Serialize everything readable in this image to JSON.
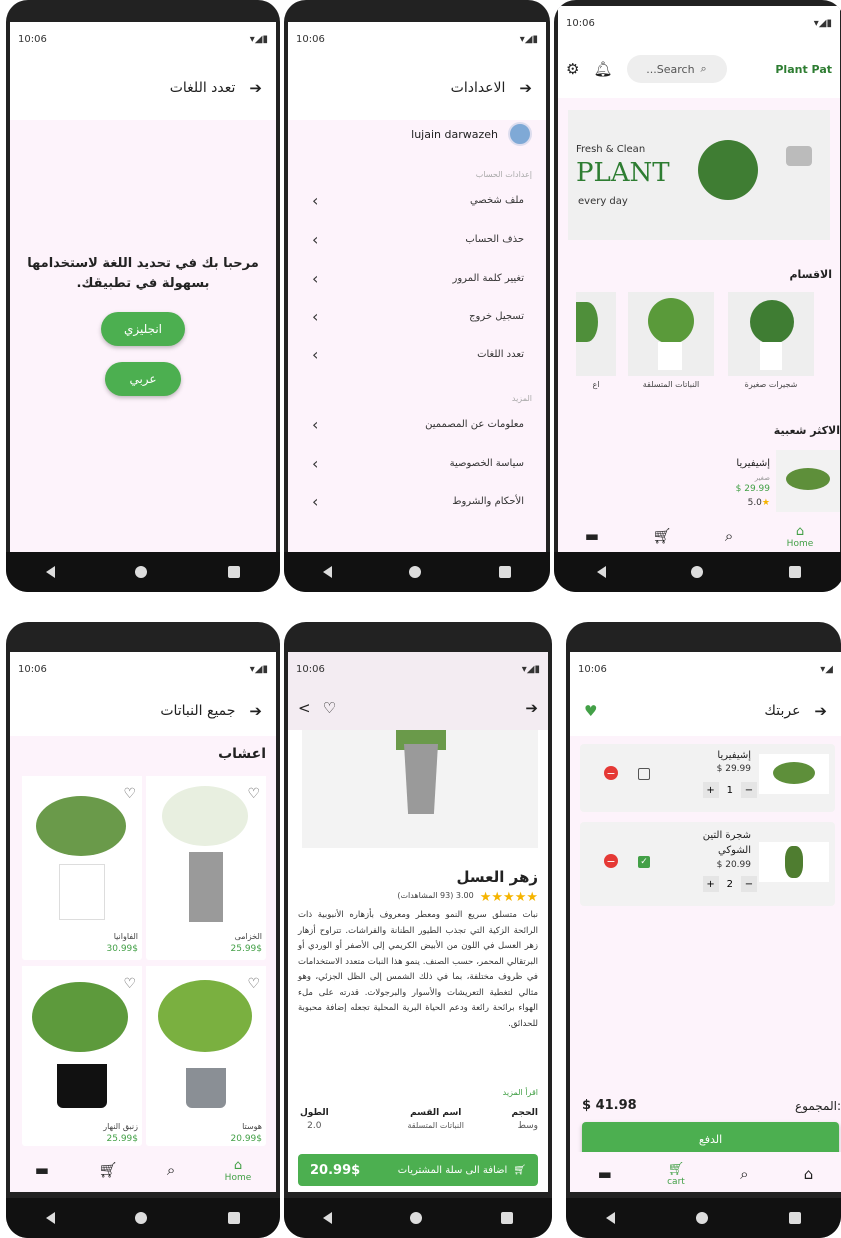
{
  "status": {
    "time": "10:06"
  },
  "languages": {
    "title": "تعدد اللغات",
    "welcome": "مرحبا بك في تحديد اللغة لاستخدامها بسهولة في تطبيقك.",
    "english_label": "انجليزي",
    "arabic_label": "عربي"
  },
  "settings": {
    "title": "الاعدادات",
    "user_name": "lujain darwazeh",
    "account_section": "إعدادات الحساب",
    "account_items": [
      "ملف شخصي",
      "حذف الحساب",
      "تغيير كلمة المرور",
      "تسجيل خروج",
      "تعدد اللغات"
    ],
    "more_section": "المزيد",
    "more_items": [
      "معلومات عن المصممين",
      "سياسة الخصوصية",
      "الأحكام والشروط"
    ]
  },
  "home": {
    "search_placeholder": "...Search",
    "logo": "Plant Pat",
    "banner": {
      "line1": "Fresh & Clean",
      "line2": "PLANT",
      "line3": "every day"
    },
    "categories_title": "الاقسام",
    "categories": [
      "شجيرات صغيرة",
      "النباتات المتسلقة",
      "اع"
    ],
    "popular_title": "الاكثر شعبية",
    "popular": {
      "name": "إشيفيريا",
      "size": "صغير",
      "price": "$ 29.99",
      "rating": "5.0"
    },
    "nav_home": "Home"
  },
  "all_plants": {
    "title": "جميع النباتات",
    "section": "اعشاب",
    "items": [
      {
        "name": "الخزامى",
        "price": "25.99$"
      },
      {
        "name": "الفاوانيا",
        "price": "30.99$"
      },
      {
        "name": "هوستا",
        "price": "20.99$"
      },
      {
        "name": "زنبق النهار",
        "price": "25.99$"
      }
    ],
    "nav_home": "Home"
  },
  "detail": {
    "name": "زهر العسل",
    "rating_text": "3.00 (93 المشاهدات)",
    "description": "نبات متسلق سريع النمو ومعطر ومعروف بأزهاره الأنبوبية ذات الرائحة الزكية التي تجذب الطيور الطنانة والفراشات. تتراوح أزهار زهر العسل في اللون من الأبيض الكريمي إلى الأصفر أو الوردي أو البرتقالي المحمر، حسب الصنف. ينمو هذا النبات متعدد الاستخدامات في ظروف مختلفة، بما في ذلك الشمس إلى الظل الجزئي، وهو مثالي لتغطية التعريشات والأسوار والبرجولات. قدرته على ملء الهواء برائحة رائعة ودعم الحياة البرية المحلية تجعله إضافة محبوبة للحدائق.",
    "read_more": "اقرأ المزيد",
    "size_label": "الحجم",
    "size_value": "وسط",
    "category_label": "اسم القسم",
    "category_value": "النباتات المتسلقة",
    "height_label": "الطول",
    "height_value": "2.0",
    "add_to_cart": "اضافة الى سلة المشتريات",
    "price": "20.99$"
  },
  "cart": {
    "title": "عربتك",
    "items": [
      {
        "name": "إشيفيريا",
        "price": "$ 29.99",
        "qty": "1"
      },
      {
        "name": "شجرة التين الشوكي",
        "price": "$ 20.99",
        "qty": "2"
      }
    ],
    "total_label": "المجموع:",
    "total_value": "$ 41.98",
    "pay_label": "الدفع",
    "nav_cart": "cart"
  },
  "colors": {
    "accent": "#4caf50",
    "background": "#fdf3fb",
    "frame": "#222222"
  }
}
